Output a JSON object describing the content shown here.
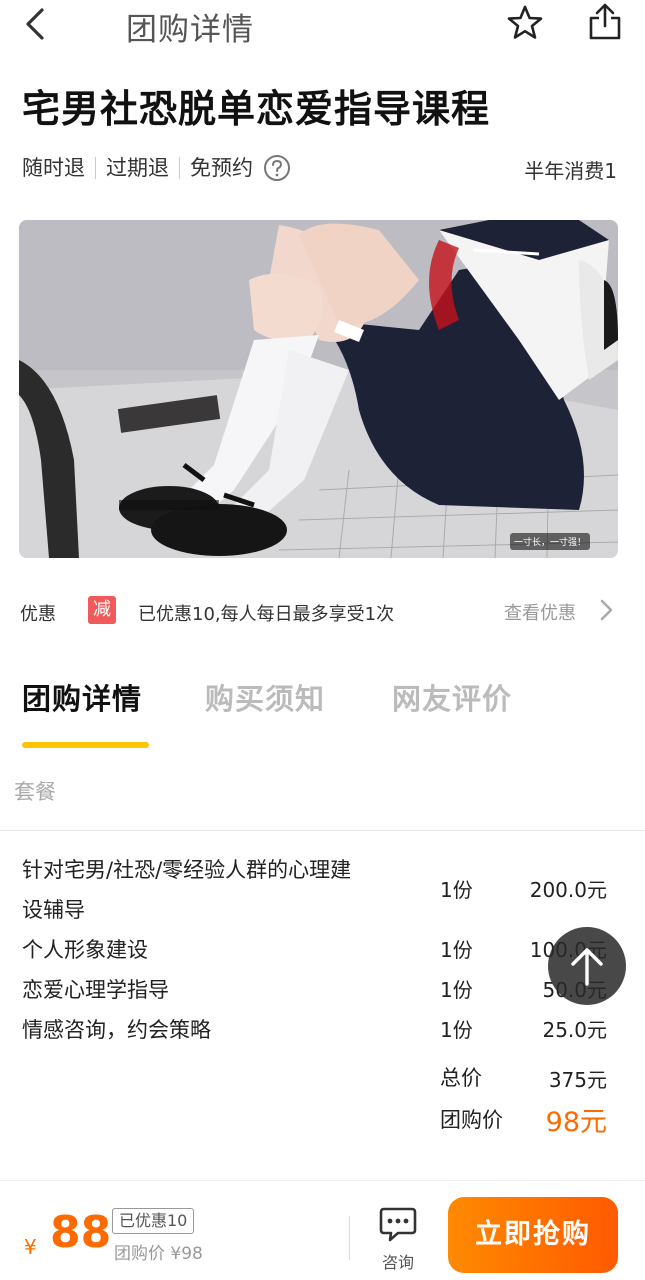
{
  "nav": {
    "title": "团购详情",
    "back_icon": "chevron-left-icon",
    "favorite_icon": "star-icon",
    "share_icon": "share-icon"
  },
  "deal": {
    "title": "宅男社恐脱单恋爱指导课程",
    "tags": [
      "随时退",
      "过期退",
      "免预约"
    ],
    "sales": "半年消费1",
    "image_caption": "一寸长，一寸强！"
  },
  "promo": {
    "label": "优惠",
    "badge": "减",
    "text": "已优惠10,每人每日最多享受1次",
    "link": "查看优惠"
  },
  "tabs": [
    {
      "label": "团购详情",
      "active": true
    },
    {
      "label": "购买须知",
      "active": false
    },
    {
      "label": "网友评价",
      "active": false
    }
  ],
  "package": {
    "section_label": "套餐",
    "items": [
      {
        "name_line1": "针对宅男/社恐/零经验人群的心理建",
        "name_line2": "设辅导",
        "qty": "1份",
        "price": "200.0元"
      },
      {
        "name_line1": "个人形象建设",
        "qty": "1份",
        "price": "100.0元"
      },
      {
        "name_line1": "恋爱心理学指导",
        "qty": "1份",
        "price": "50.0元"
      },
      {
        "name_line1": "情感咨询，约会策略",
        "qty": "1份",
        "price": "25.0元"
      }
    ],
    "total_label": "总价",
    "total_value": "375元",
    "group_label": "团购价",
    "group_value": "98元"
  },
  "bottom": {
    "currency": "¥",
    "price": "88",
    "discount": "已优惠10",
    "orig": "团购价 ¥98",
    "consult_label": "咨询",
    "buy_label": "立即抢购"
  },
  "colors": {
    "accent": "#ff6a00",
    "tab_underline": "#ffc300",
    "badge": "#f05a5a"
  }
}
